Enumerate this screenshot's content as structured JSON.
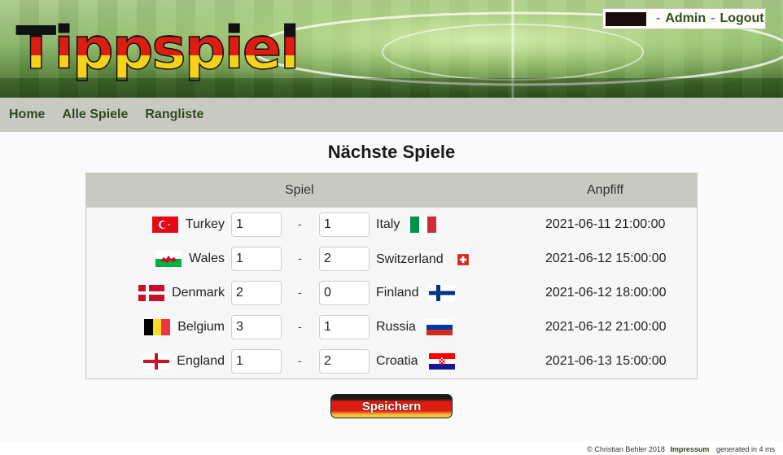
{
  "header": {
    "logo_text": "Tippspiel",
    "user": {
      "name_redacted": "",
      "separator_1": "-",
      "admin_label": "Admin",
      "separator_2": "-",
      "logout_label": "Logout"
    }
  },
  "nav": {
    "items": [
      {
        "label": "Home"
      },
      {
        "label": "Alle Spiele"
      },
      {
        "label": "Rangliste"
      }
    ]
  },
  "main": {
    "title": "Nächste Spiele",
    "columns": {
      "game": "Spiel",
      "kickoff": "Anpfiff"
    },
    "games": [
      {
        "home": "Turkey",
        "home_flag": "turkey-flag-icon",
        "home_score": "1",
        "separator": "-",
        "away_score": "1",
        "away": "Italy",
        "away_flag": "italy-flag-icon",
        "kickoff": "2021-06-11 21:00:00"
      },
      {
        "home": "Wales",
        "home_flag": "wales-flag-icon",
        "home_score": "1",
        "separator": "-",
        "away_score": "2",
        "away": "Switzerland",
        "away_flag": "switzerland-flag-icon",
        "kickoff": "2021-06-12 15:00:00"
      },
      {
        "home": "Denmark",
        "home_flag": "denmark-flag-icon",
        "home_score": "2",
        "separator": "-",
        "away_score": "0",
        "away": "Finland",
        "away_flag": "finland-flag-icon",
        "kickoff": "2021-06-12 18:00:00"
      },
      {
        "home": "Belgium",
        "home_flag": "belgium-flag-icon",
        "home_score": "3",
        "separator": "-",
        "away_score": "1",
        "away": "Russia",
        "away_flag": "russia-flag-icon",
        "kickoff": "2021-06-12 21:00:00"
      },
      {
        "home": "England",
        "home_flag": "england-flag-icon",
        "home_score": "1",
        "separator": "-",
        "away_score": "2",
        "away": "Croatia",
        "away_flag": "croatia-flag-icon",
        "kickoff": "2021-06-13 15:00:00"
      }
    ],
    "save_label": "Speichern"
  },
  "footer": {
    "copyright": "© Christian Behler 2018",
    "impressum": "Impressum",
    "generated": "generated in 4 ms"
  },
  "colors": {
    "nav_background": "#c8cac2",
    "link_green": "#2f4a1f",
    "flag_red": "#dd1d12",
    "flag_gold": "#f7d21c"
  }
}
